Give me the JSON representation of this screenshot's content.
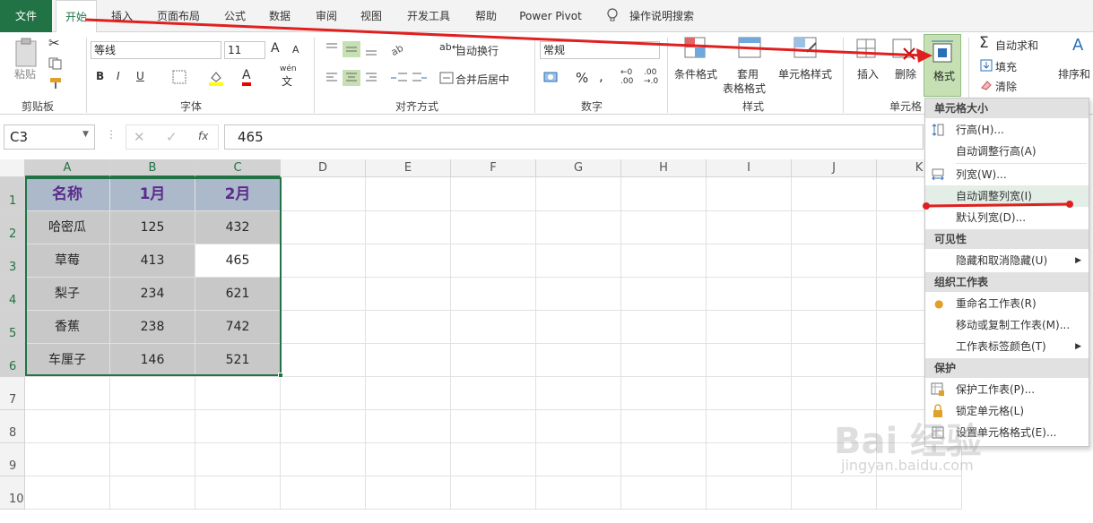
{
  "tabs": [
    "文件",
    "开始",
    "插入",
    "页面布局",
    "公式",
    "数据",
    "审阅",
    "视图",
    "开发工具",
    "帮助",
    "Power Pivot",
    "操作说明搜索"
  ],
  "ribbon": {
    "clipboard": {
      "paste": "粘贴",
      "label": "剪贴板"
    },
    "font": {
      "name": "等线",
      "size": "11",
      "label": "字体",
      "bold": "B",
      "italic": "I",
      "underline": "U",
      "font_grow": "A",
      "font_shrink": "A",
      "font_color": "A",
      "phonetic": "wén",
      "phonetic_char": "文"
    },
    "alignment": {
      "wrap": "自动换行",
      "merge": "合并后居中",
      "label": "对齐方式"
    },
    "number": {
      "format": "常规",
      "label": "数字",
      "percent": "%",
      "comma": ","
    },
    "styles": {
      "conditional": "条件格式",
      "table_1": "套用",
      "table_2": "表格格式",
      "cell_styles": "单元格样式",
      "label": "样式"
    },
    "cells": {
      "insert": "插入",
      "delete": "删除",
      "format": "格式",
      "label": "单元格"
    },
    "editing": {
      "autosum": "自动求和",
      "fill": "填充",
      "clear": "清除",
      "sort": "排序和"
    }
  },
  "formula_bar": {
    "name_box": "C3",
    "fx": "fx",
    "value": "465"
  },
  "columns": [
    "A",
    "B",
    "C",
    "D",
    "E",
    "F",
    "G",
    "H",
    "I",
    "J",
    "K"
  ],
  "rows": [
    "1",
    "2",
    "3",
    "4",
    "5",
    "6",
    "7",
    "8",
    "9",
    "10"
  ],
  "table": {
    "headers": [
      "名称",
      "1月",
      "2月"
    ],
    "rows": [
      [
        "哈密瓜",
        "125",
        "432"
      ],
      [
        "草莓",
        "413",
        "465"
      ],
      [
        "梨子",
        "234",
        "621"
      ],
      [
        "香蕉",
        "238",
        "742"
      ],
      [
        "车厘子",
        "146",
        "521"
      ]
    ]
  },
  "menu": {
    "sec_size": "单元格大小",
    "row_height": "行高(H)...",
    "autofit_row": "自动调整行高(A)",
    "col_width": "列宽(W)...",
    "autofit_col": "自动调整列宽(I)",
    "default_width": "默认列宽(D)...",
    "sec_visibility": "可见性",
    "hide_unhide": "隐藏和取消隐藏(U)",
    "sec_organize": "组织工作表",
    "rename": "重命名工作表(R)",
    "move_copy": "移动或复制工作表(M)...",
    "tab_color": "工作表标签颜色(T)",
    "sec_protect": "保护",
    "protect_sheet": "保护工作表(P)...",
    "lock_cell": "锁定单元格(L)",
    "format_cells": "设置单元格格式(E)..."
  },
  "watermark": {
    "brand": "Bai 经验",
    "url": "jingyan.baidu.com"
  },
  "colors": {
    "accent": "#217346",
    "arrow": "#e02020",
    "header_fill": "#acb9ca",
    "data_fill": "#c8c8c8"
  }
}
